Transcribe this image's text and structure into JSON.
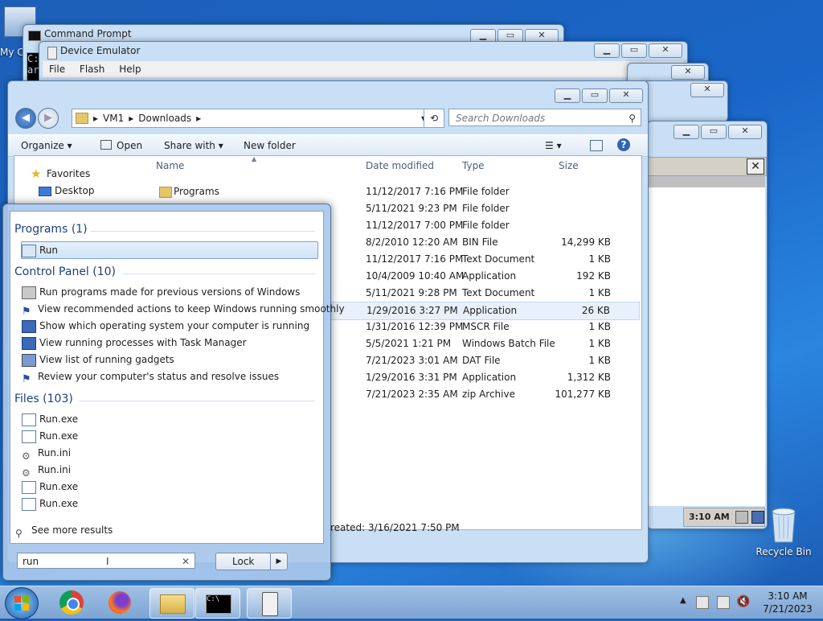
{
  "desktop": {
    "my_computer_label": "My C",
    "recycle_bin_label": "Recycle Bin"
  },
  "windows": {
    "cmd": {
      "title": "Command Prompt",
      "prompt_glyph": "C:",
      "prompt_glyph2": "ar"
    },
    "emulator": {
      "title": "Device Emulator",
      "menu": [
        "File",
        "Flash",
        "Help"
      ]
    },
    "small": {
      "time": "3:10 AM"
    }
  },
  "explorer": {
    "breadcrumb": [
      "VM1",
      "Downloads"
    ],
    "search_placeholder": "Search Downloads",
    "toolbar": {
      "organize": "Organize",
      "open": "Open",
      "share_with": "Share with",
      "new_folder": "New folder"
    },
    "columns": {
      "name": "Name",
      "date": "Date modified",
      "type": "Type",
      "size": "Size"
    },
    "nav": {
      "favorites": "Favorites",
      "desktop": "Desktop"
    },
    "first_row_name": "Programs",
    "rows": [
      {
        "date": "11/12/2017 7:16 PM",
        "type": "File folder",
        "size": ""
      },
      {
        "date": "5/11/2021 9:23 PM",
        "type": "File folder",
        "size": ""
      },
      {
        "date": "11/12/2017 7:00 PM",
        "type": "File folder",
        "size": ""
      },
      {
        "date": "8/2/2010 12:20 AM",
        "type": "BIN File",
        "size": "14,299 KB"
      },
      {
        "date": "11/12/2017 7:16 PM",
        "type": "Text Document",
        "size": "1 KB"
      },
      {
        "date": "10/4/2009 10:40 AM",
        "type": "Application",
        "size": "192 KB"
      },
      {
        "date": "5/11/2021 9:28 PM",
        "type": "Text Document",
        "size": "1 KB"
      },
      {
        "date": "1/29/2016 3:27 PM",
        "type": "Application",
        "size": "26 KB"
      },
      {
        "date": "1/31/2016 12:39 PM",
        "type": "MSCR File",
        "size": "1 KB"
      },
      {
        "date": "5/5/2021 1:21 PM",
        "type": "Windows Batch File",
        "size": "1 KB"
      },
      {
        "date": "7/21/2023 3:01 AM",
        "type": "DAT File",
        "size": "1 KB"
      },
      {
        "date": "1/29/2016 3:31 PM",
        "type": "Application",
        "size": "1,312 KB"
      },
      {
        "date": "7/21/2023 2:35 AM",
        "type": "zip Archive",
        "size": "101,277 KB"
      }
    ],
    "status_created": "reated: 3/16/2021 7:50 PM"
  },
  "start_menu": {
    "programs_header": "Programs (1)",
    "programs": [
      "Run"
    ],
    "control_panel_header": "Control Panel (10)",
    "control_panel": [
      "Run programs made for previous versions of Windows",
      "View recommended actions to keep Windows running smoothly",
      "Show which operating system your computer is running",
      "View running processes with Task Manager",
      "View list of running gadgets",
      "Review your computer's status and resolve issues"
    ],
    "files_header": "Files (103)",
    "files": [
      "Run.exe",
      "Run.exe",
      "Run.ini",
      "Run.ini",
      "Run.exe",
      "Run.exe"
    ],
    "see_more": "See more results",
    "search_value": "run",
    "lock_label": "Lock"
  },
  "taskbar": {
    "time": "3:10 AM",
    "date": "7/21/2023"
  },
  "colors": {
    "accent": "#1e3e80",
    "desktop": "#1a66c8"
  }
}
